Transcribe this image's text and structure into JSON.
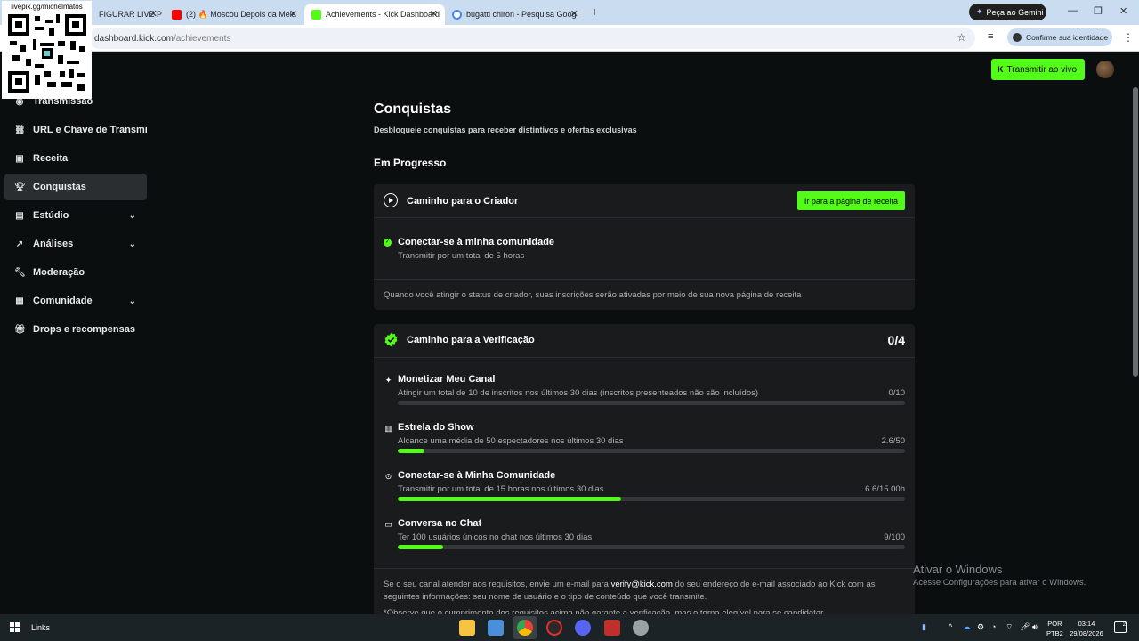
{
  "browser": {
    "tabs": [
      {
        "label": "FIGURAR LIVE P",
        "favicon_color": "#e0e0e0"
      },
      {
        "label": "(2) 🔥 Moscou Depois da Meia",
        "favicon_color": "#ff0000"
      },
      {
        "label": "Achievements - Kick Dashboard",
        "favicon_color": "#53fc18"
      },
      {
        "label": "bugatti chiron - Pesquisa Goog",
        "favicon_color": "#4285f4"
      }
    ],
    "gemini_label": "Peça ao Gemini",
    "url_host": "dashboard.kick.com",
    "url_path": "/achievements",
    "confirm_label": "Confirme sua identidade"
  },
  "overlay": {
    "qr_label": "livepix.gg/michelmatos"
  },
  "header": {
    "golive_label": "Transmitir ao vivo"
  },
  "sidebar": {
    "items": [
      {
        "label": "Transmissão",
        "icon": "broadcast-icon"
      },
      {
        "label": "URL e Chave de Transmissão",
        "icon": "link-icon"
      },
      {
        "label": "Receita",
        "icon": "revenue-icon"
      },
      {
        "label": "Conquistas",
        "icon": "trophy-icon",
        "active": true
      },
      {
        "label": "Estúdio",
        "icon": "studio-icon",
        "expandable": true
      },
      {
        "label": "Análises",
        "icon": "analytics-icon",
        "expandable": true
      },
      {
        "label": "Moderação",
        "icon": "wrench-icon"
      },
      {
        "label": "Comunidade",
        "icon": "community-icon",
        "expandable": true
      },
      {
        "label": "Drops e recompensas",
        "icon": "gift-icon"
      }
    ]
  },
  "main": {
    "title": "Conquistas",
    "subtitle": "Desbloqueie conquistas para receber distintivos e ofertas exclusivas",
    "section_title": "Em Progresso",
    "creator": {
      "title": "Caminho para o Criador",
      "button_label": "Ir para a página de receita",
      "task_title": "Conectar-se à minha comunidade",
      "task_desc": "Transmitir por um total de 5 horas",
      "note": "Quando você atingir o status de criador, suas inscrições serão ativadas por meio de sua nova página de receita"
    },
    "verification": {
      "title": "Caminho para a Verificação",
      "count": "0/4",
      "requirements": [
        {
          "title": "Monetizar Meu Canal",
          "desc": "Atingir um total de 10 de inscritos nos últimos 30 dias (inscritos presenteados não são incluídos)",
          "value": "0/10",
          "progress": 0.0,
          "icon": "sparkle-icon"
        },
        {
          "title": "Estrela do Show",
          "desc": "Alcance uma média de 50 espectadores nos últimos 30 dias",
          "value": "2.6/50",
          "progress": 0.052,
          "icon": "viewers-icon"
        },
        {
          "title": "Conectar-se à Minha Comunidade",
          "desc": "Transmitir por um total de 15 horas nos últimos 30 dias",
          "value": "6.6/15.00h",
          "progress": 0.44,
          "icon": "play-circle-icon"
        },
        {
          "title": "Conversa no Chat",
          "desc": "Ter 100 usuários únicos no chat nos últimos 30 dias",
          "value": "9/100",
          "progress": 0.09,
          "icon": "chat-icon"
        }
      ],
      "note_before_link": "Se o seu canal atender aos requisitos, envie um e-mail para ",
      "note_link": "verify@kick.com",
      "note_after_link": " do seu endereço de e-mail associado ao Kick com as seguintes informações: seu nome de usuário e o tipo de conteúdo que você transmite.",
      "disclaimer": "*Observe que o cumprimento dos requisitos acima não garante a verificação, mas o torna elegível para se candidatar."
    }
  },
  "watermark": {
    "line1": "Ativar o Windows",
    "line2": "Acesse Configurações para ativar o Windows."
  },
  "taskbar": {
    "links_label": "Links",
    "lang_line1": "POR",
    "lang_line2": "PTB2",
    "time": "03:14",
    "date": "29/08/2026",
    "notif_count": "2"
  }
}
